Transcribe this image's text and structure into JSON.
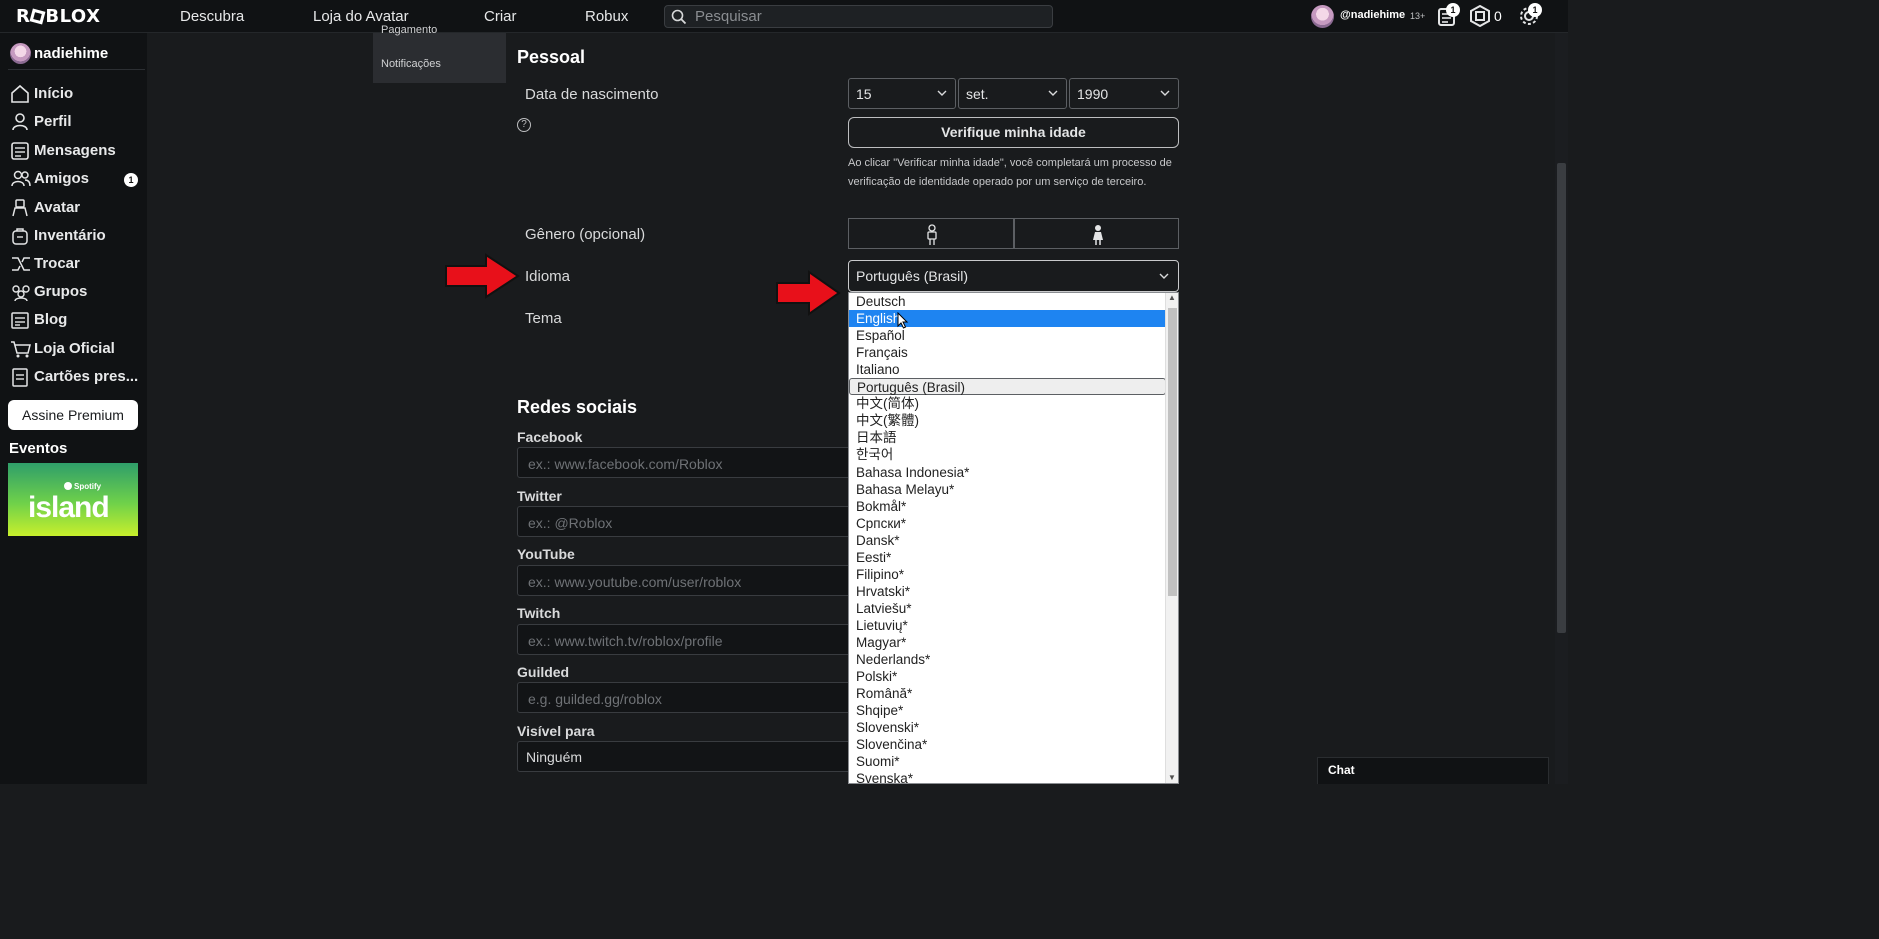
{
  "topbar": {
    "logo": "ROBLOX",
    "nav": [
      "Descubra",
      "Loja do Avatar",
      "Criar",
      "Robux"
    ],
    "search_placeholder": "Pesquisar",
    "username": "@nadiehime",
    "age_label": "13+",
    "notifications_badge": "1",
    "robux_count": "0",
    "settings_badge": "1"
  },
  "sidebar": {
    "username": "nadiehime",
    "items": [
      {
        "label": "Início",
        "icon": "home-icon"
      },
      {
        "label": "Perfil",
        "icon": "profile-icon"
      },
      {
        "label": "Mensagens",
        "icon": "messages-icon"
      },
      {
        "label": "Amigos",
        "icon": "friends-icon",
        "badge": "1"
      },
      {
        "label": "Avatar",
        "icon": "avatar-icon"
      },
      {
        "label": "Inventário",
        "icon": "inventory-icon"
      },
      {
        "label": "Trocar",
        "icon": "trade-icon"
      },
      {
        "label": "Grupos",
        "icon": "groups-icon"
      },
      {
        "label": "Blog",
        "icon": "blog-icon"
      },
      {
        "label": "Loja Oficial",
        "icon": "shop-icon"
      },
      {
        "label": "Cartões pres...",
        "icon": "gift-card-icon"
      }
    ],
    "premium_button": "Assine Premium",
    "events_title": "Eventos",
    "event_banner": {
      "brand": "Spotify",
      "title": "island"
    }
  },
  "settings_menu": {
    "cut_item": "Pagamento",
    "item": "Notificações"
  },
  "personal": {
    "title": "Pessoal",
    "birthdate_label": "Data de nascimento",
    "birth_day": "15",
    "birth_month": "set.",
    "birth_year": "1990",
    "verify_button": "Verifique minha idade",
    "verify_note": "Ao clicar \"Verificar minha idade\", você completará um processo de verificação de identidade operado por um serviço de terceiro.",
    "gender_label": "Gênero (opcional)",
    "language_label": "Idioma",
    "language_value": "Português (Brasil)",
    "theme_label": "Tema"
  },
  "language_options": [
    "Deutsch",
    "English",
    "Español",
    "Français",
    "Italiano",
    "Português (Brasil)",
    "中文(简体)",
    "中文(繁體)",
    "日本語",
    "한국어",
    "Bahasa Indonesia*",
    "Bahasa Melayu*",
    "Bokmål*",
    "Српски*",
    "Dansk*",
    "Eesti*",
    "Filipino*",
    "Hrvatski*",
    "Latviešu*",
    "Lietuvių*",
    "Magyar*",
    "Nederlands*",
    "Polski*",
    "Română*",
    "Shqipe*",
    "Slovenski*",
    "Slovenčina*",
    "Suomi*",
    "Svenska*"
  ],
  "language_highlighted": "English",
  "social": {
    "title": "Redes sociais",
    "fields": [
      {
        "label": "Facebook",
        "placeholder": "ex.: www.facebook.com/Roblox"
      },
      {
        "label": "Twitter",
        "placeholder": "ex.: @Roblox"
      },
      {
        "label": "YouTube",
        "placeholder": "ex.: www.youtube.com/user/roblox"
      },
      {
        "label": "Twitch",
        "placeholder": "ex.: www.twitch.tv/roblox/profile"
      },
      {
        "label": "Guilded",
        "placeholder": "e.g. guilded.gg/roblox"
      }
    ],
    "visible_label": "Visível para",
    "visible_value": "Ninguém"
  },
  "chat": {
    "label": "Chat"
  },
  "colors": {
    "highlight": "#1e84f1",
    "arrow": "#e8101a",
    "background": "#191b1d"
  }
}
